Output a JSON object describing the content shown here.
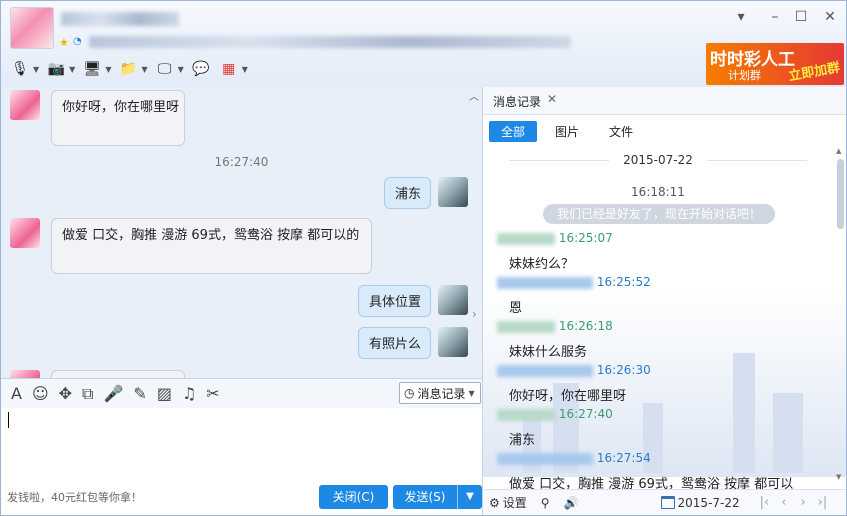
{
  "window": {
    "controls": {
      "menu": "▾",
      "minimize": "–",
      "maximize": "☐",
      "close": "✕"
    }
  },
  "ad": {
    "line1": "时时彩人工",
    "line2": "计划群",
    "line3": "立即加群"
  },
  "toolbar": {
    "items": [
      {
        "icon": "microphone-icon",
        "glyph": "🎙"
      },
      {
        "icon": "camera-icon",
        "glyph": "📷"
      },
      {
        "icon": "screen-share-icon",
        "glyph": "🖥"
      },
      {
        "icon": "file-transfer-icon",
        "glyph": "📁"
      },
      {
        "icon": "remote-desktop-icon",
        "glyph": "🖵"
      },
      {
        "icon": "add-app-icon",
        "glyph": "💬"
      },
      {
        "icon": "apps-grid-icon",
        "glyph": "▦"
      }
    ]
  },
  "chat": {
    "messages": [
      {
        "side": "left",
        "text": "你好呀，你在哪里呀"
      },
      {
        "time": "16:27:40"
      },
      {
        "side": "right",
        "text": "浦东"
      },
      {
        "side": "left",
        "text": "做爱 口交，胸推 漫游 69式，鸳鸯浴   按摩 都可以的"
      },
      {
        "side": "right",
        "text": "具体位置"
      },
      {
        "side": "right",
        "text": "有照片么"
      }
    ]
  },
  "input_toolbar": {
    "history_label": "消息记录",
    "icons": [
      "font-icon",
      "emoji-icon",
      "shake-icon",
      "screenshot-icon",
      "voice-icon",
      "edit-icon",
      "image-icon",
      "music-icon",
      "cut-icon"
    ]
  },
  "footer": {
    "hint": "发钱啦，40元红包等你拿！",
    "close_label": "关闭(C)",
    "send_label": "发送(S)"
  },
  "history": {
    "tab_label": "消息记录",
    "filters": [
      "全部",
      "图片",
      "文件"
    ],
    "date": "2015-07-22",
    "sys_time": "16:18:11",
    "sys_msg": "我们已经是好友了，现在开始对话吧！",
    "entries": [
      {
        "who": "g",
        "time": "16:25:07",
        "text": "妹妹约么？"
      },
      {
        "who": "b",
        "time": "16:25:52",
        "text": "恩"
      },
      {
        "who": "g",
        "time": "16:26:18",
        "text": "妹妹什么服务"
      },
      {
        "who": "b",
        "time": "16:26:30",
        "text": "你好呀，你在哪里呀"
      },
      {
        "who": "g",
        "time": "16:27:40",
        "text": "浦东"
      },
      {
        "who": "b",
        "time": "16:27:54",
        "text": "做爱 口交，胸推 漫游 69式，鸳鸯浴   按摩 都可以"
      }
    ],
    "footer": {
      "settings": "设置",
      "date": "2015-7-22"
    }
  },
  "colors": {
    "accent": "#1e88e5",
    "peer_time": "#3a9e6a",
    "self_time": "#2a7bd0"
  }
}
